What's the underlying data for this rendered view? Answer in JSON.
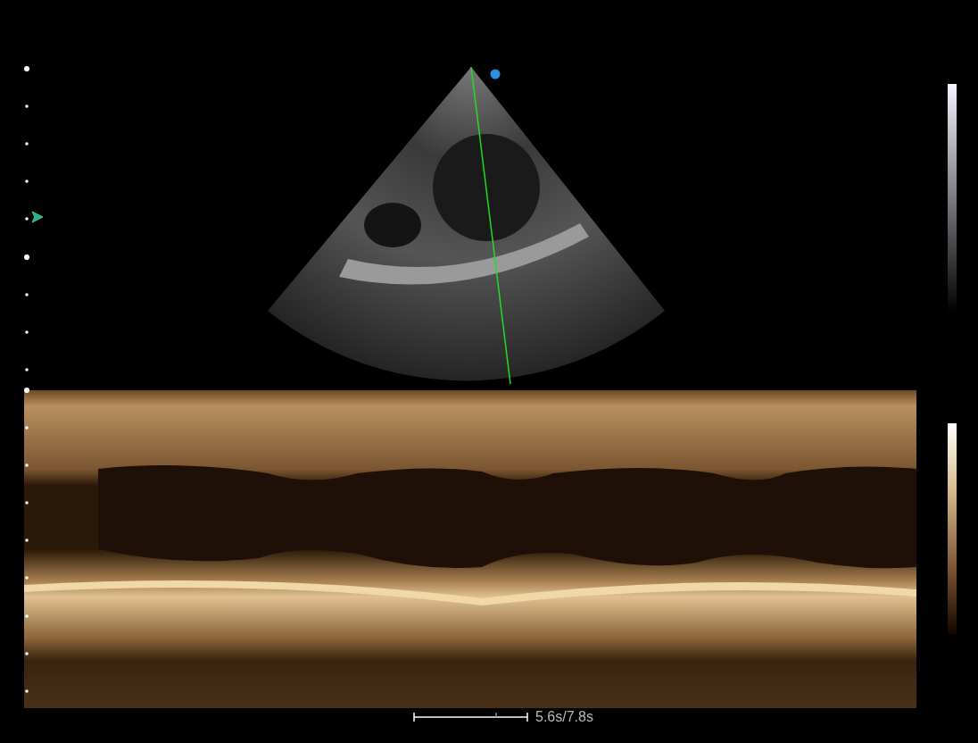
{
  "time_scale": {
    "label": "5.6s/7.8s"
  }
}
